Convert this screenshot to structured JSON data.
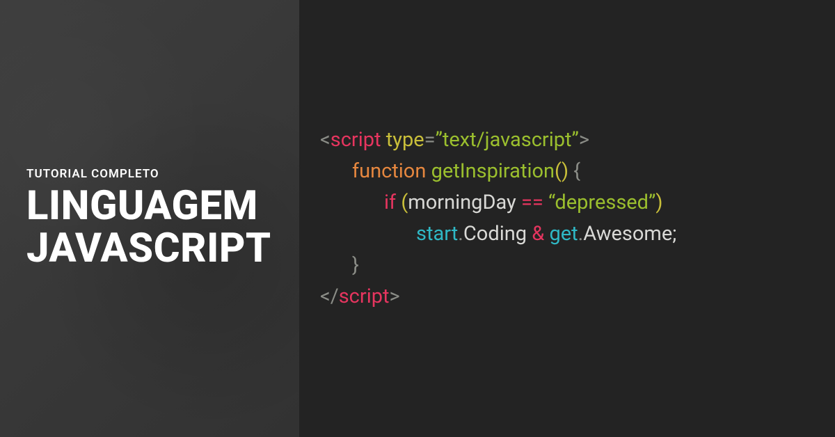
{
  "left": {
    "subtitle": "TUTORIAL COMPLETO",
    "title_line1": "LINGUAGEM",
    "title_line2": "JAVASCRIPT"
  },
  "code": {
    "lt": "<",
    "gt": ">",
    "slash": "/",
    "script_tag": "script",
    "type_attr": "type",
    "eq": "=",
    "type_val": "”text/javascript”",
    "fn_kw": "function",
    "fn_name": "getInspiration",
    "paren_open": "(",
    "paren_close": ")",
    "brace_open": "{",
    "brace_close": "}",
    "if_kw": "if",
    "var_morning": "morningDay ",
    "eqeq": "== ",
    "str_dep": "“depressed”",
    "start": "start",
    "dot": ".",
    "coding": "Coding ",
    "amp": "& ",
    "get": "get",
    "awesome": "Awesome;"
  }
}
